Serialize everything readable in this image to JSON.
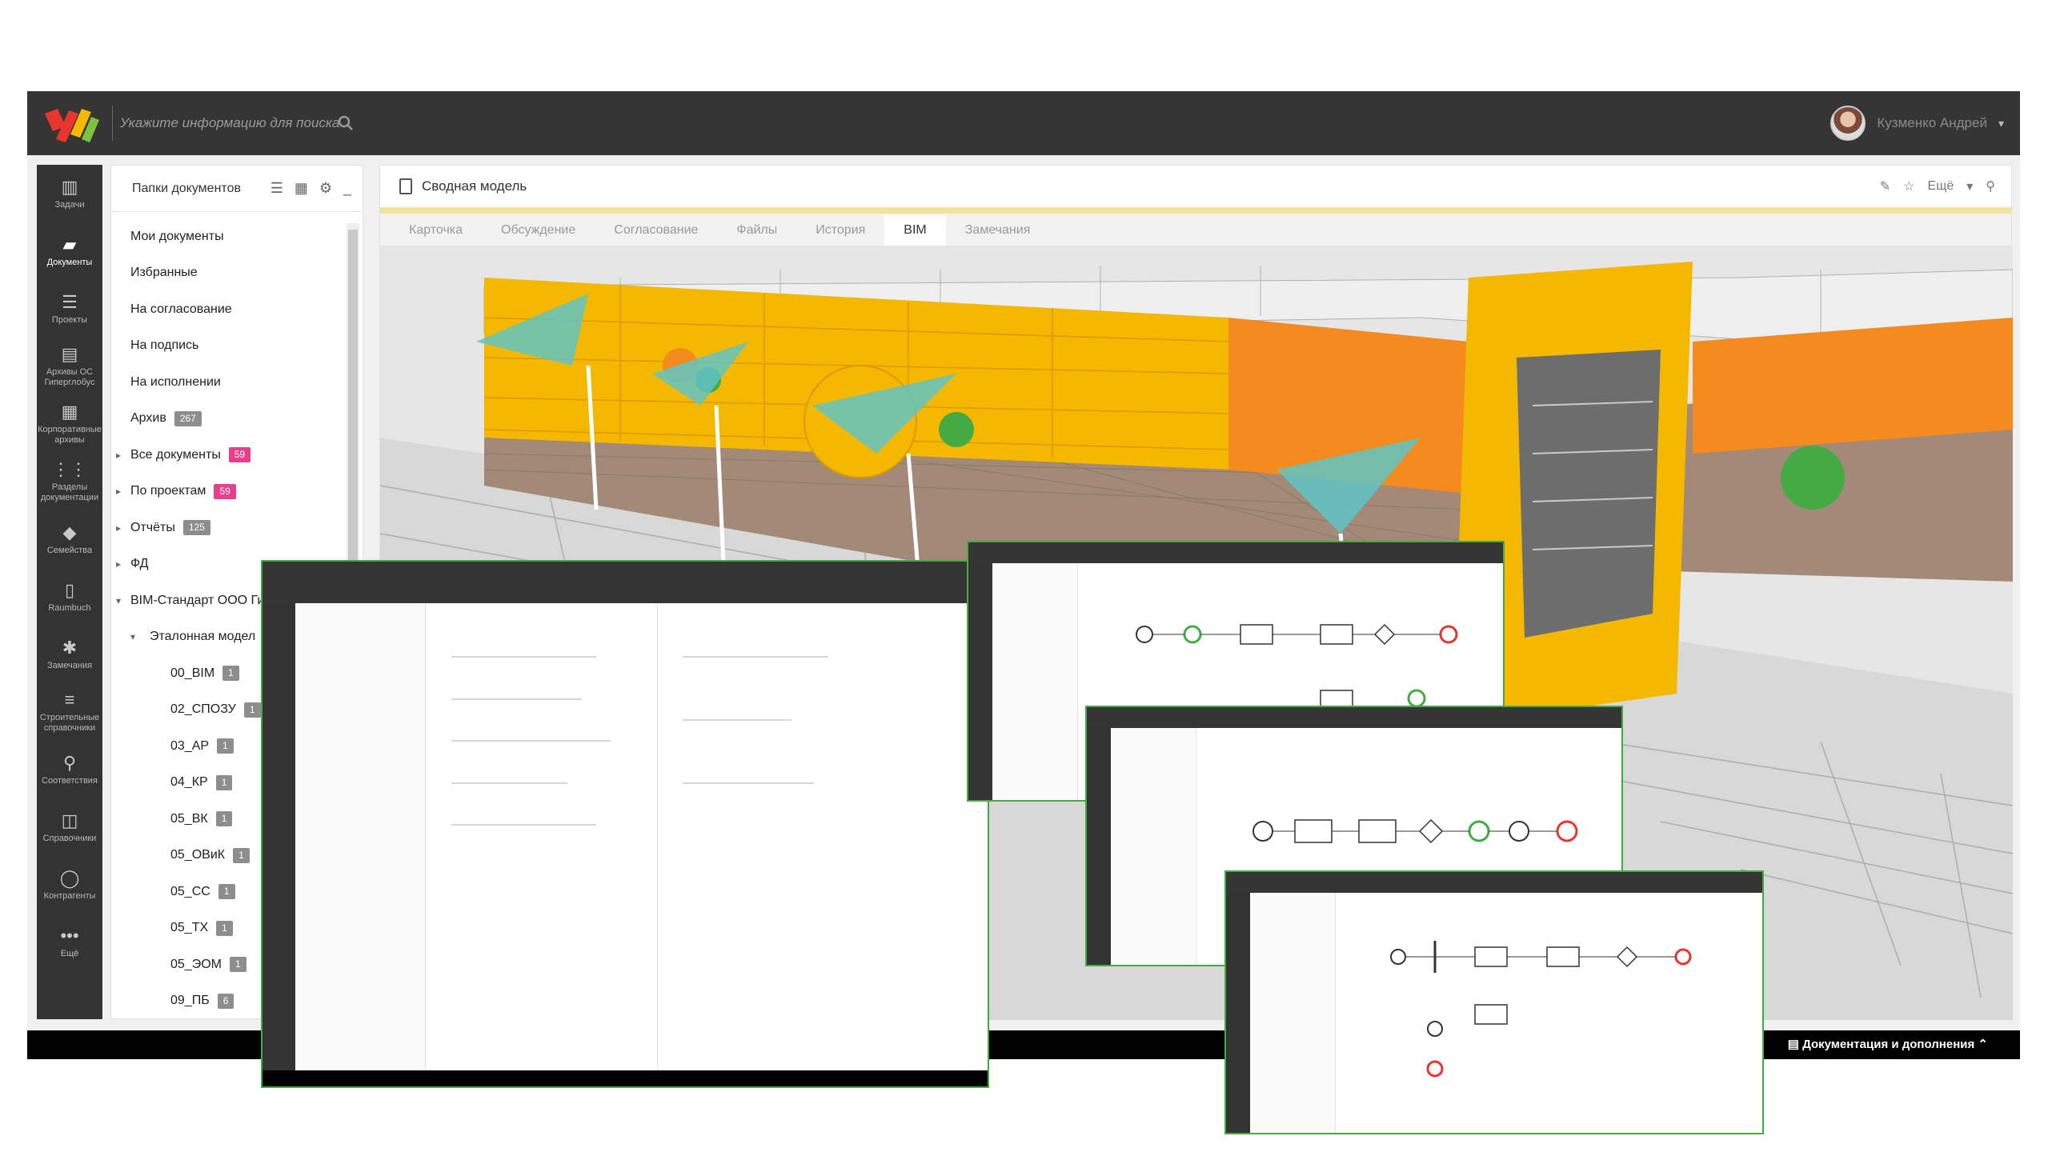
{
  "header": {
    "search_placeholder": "Укажите информацию для поиска",
    "user_name": "Кузменко Андрей"
  },
  "nav": {
    "items": [
      {
        "label": "Задачи",
        "icon": "clipboard-icon"
      },
      {
        "label": "Документы",
        "icon": "folder-open-icon",
        "active": true
      },
      {
        "label": "Проекты",
        "icon": "projects-icon"
      },
      {
        "label": "Архивы ОС Гиперглобус",
        "icon": "archive-icon"
      },
      {
        "label": "Корпоративные архивы",
        "icon": "grid-icon"
      },
      {
        "label": "Разделы документации",
        "icon": "sections-icon"
      },
      {
        "label": "Семейства",
        "icon": "tags-icon"
      },
      {
        "label": "Raumbuch",
        "icon": "book-icon"
      },
      {
        "label": "Замечания",
        "icon": "bug-icon"
      },
      {
        "label": "Строительные справочники",
        "icon": "list-icon"
      },
      {
        "label": "Соответствия",
        "icon": "link-icon"
      },
      {
        "label": "Справочники",
        "icon": "open-book-icon"
      },
      {
        "label": "Контрагенты",
        "icon": "person-icon"
      },
      {
        "label": "Ещё",
        "icon": "more-icon"
      }
    ]
  },
  "folders": {
    "title": "Папки документов",
    "items": [
      {
        "label": "Мои документы",
        "level": 0,
        "arrow": ""
      },
      {
        "label": "Избранные",
        "level": 0,
        "arrow": ""
      },
      {
        "label": "На согласование",
        "level": 0,
        "arrow": ""
      },
      {
        "label": "На подпись",
        "level": 0,
        "arrow": ""
      },
      {
        "label": "На исполнении",
        "level": 0,
        "arrow": ""
      },
      {
        "label": "Архив",
        "level": 0,
        "arrow": "",
        "badge": "267",
        "badge_color": "gray"
      },
      {
        "label": "Все документы",
        "level": 0,
        "arrow": "▸",
        "badge": "59",
        "badge_color": "pink"
      },
      {
        "label": "По проектам",
        "level": 0,
        "arrow": "▸",
        "badge": "59",
        "badge_color": "pink"
      },
      {
        "label": "Отчёты",
        "level": 0,
        "arrow": "▸",
        "badge": "125",
        "badge_color": "gray"
      },
      {
        "label": "ФД",
        "level": 0,
        "arrow": "▸"
      },
      {
        "label": "BIM-Стандарт ООО Ги",
        "level": 0,
        "arrow": "▾"
      },
      {
        "label": "Эталонная модел",
        "level": 1,
        "arrow": "▾"
      },
      {
        "label": "00_BIM",
        "level": 2,
        "badge": "1",
        "badge_color": "gray"
      },
      {
        "label": "02_СПОЗУ",
        "level": 2,
        "badge": "1",
        "badge_color": "gray"
      },
      {
        "label": "03_АР",
        "level": 2,
        "badge": "1",
        "badge_color": "gray"
      },
      {
        "label": "04_КР",
        "level": 2,
        "badge": "1",
        "badge_color": "gray"
      },
      {
        "label": "05_ВК",
        "level": 2,
        "badge": "1",
        "badge_color": "gray"
      },
      {
        "label": "05_ОВиК",
        "level": 2,
        "badge": "1",
        "badge_color": "gray"
      },
      {
        "label": "05_СС",
        "level": 2,
        "badge": "1",
        "badge_color": "gray"
      },
      {
        "label": "05_ТХ",
        "level": 2,
        "badge": "1",
        "badge_color": "gray"
      },
      {
        "label": "05_ЭОМ",
        "level": 2,
        "badge": "1",
        "badge_color": "gray"
      },
      {
        "label": "09_ПБ",
        "level": 2,
        "badge": "6",
        "badge_color": "gray"
      }
    ]
  },
  "main": {
    "title": "Сводная модель",
    "more_label": "Ещё",
    "tabs": [
      {
        "label": "Карточка"
      },
      {
        "label": "Обсуждение"
      },
      {
        "label": "Согласование"
      },
      {
        "label": "Файлы"
      },
      {
        "label": "История"
      },
      {
        "label": "BIM",
        "active": true
      },
      {
        "label": "Замечания"
      }
    ]
  },
  "footer": {
    "docs_link": "Документация и дополнения"
  },
  "colors": {
    "topbar": "#353535",
    "nav": "#333333",
    "facade_yellow": "#f5b800",
    "facade_orange": "#f58a1e",
    "wall_brown": "#a38a78",
    "highlight_green": "#44aa44"
  }
}
